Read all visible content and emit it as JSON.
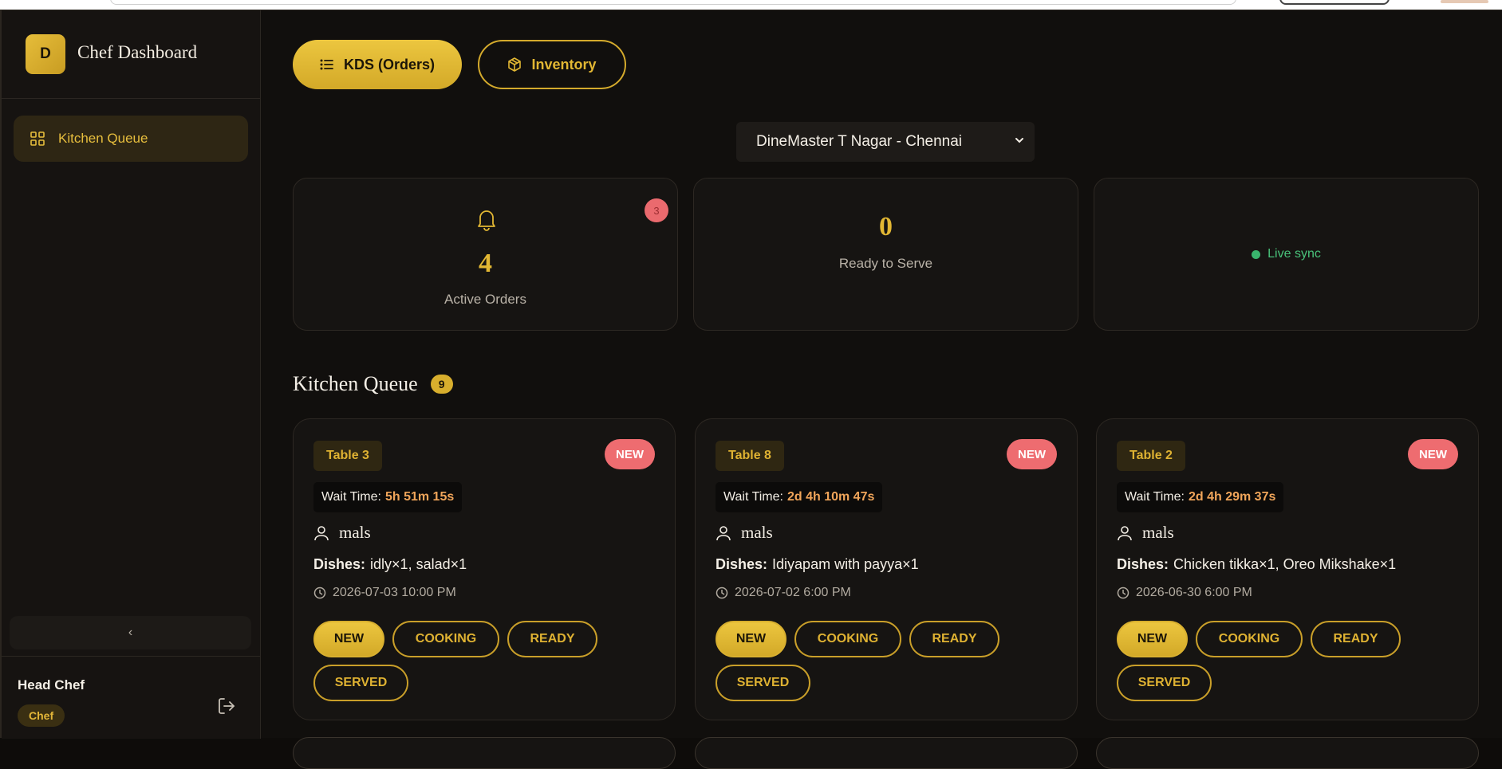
{
  "sidebar": {
    "brand_initial": "D",
    "brand_title": "Chef Dashboard",
    "nav_items": [
      {
        "label": "Kitchen Queue",
        "icon": "grid-icon",
        "active": true
      }
    ],
    "collapse_glyph": "‹",
    "user": {
      "name": "Head Chef",
      "role": "Chef"
    }
  },
  "tabs": [
    {
      "label": "KDS (Orders)",
      "icon": "list-icon",
      "active": true
    },
    {
      "label": "Inventory",
      "icon": "box-icon",
      "active": false
    }
  ],
  "branch_select": {
    "value": "DineMaster T Nagar - Chennai"
  },
  "stats": {
    "active_orders": {
      "value": "4",
      "label": "Active Orders",
      "alert": "3"
    },
    "ready_to_serve": {
      "value": "0",
      "label": "Ready to Serve"
    },
    "sync": {
      "label": "Live sync"
    }
  },
  "queue": {
    "title": "Kitchen Queue",
    "count": "9",
    "orders": [
      {
        "table": "Table 3",
        "status_badge": "NEW",
        "wait_label": "Wait Time:",
        "wait_value": "5h 51m 15s",
        "customer": "mals",
        "dishes_label": "Dishes:",
        "dishes": "idly×1, salad×1",
        "time": "2026-07-03 10:00 PM"
      },
      {
        "table": "Table 8",
        "status_badge": "NEW",
        "wait_label": "Wait Time:",
        "wait_value": "2d 4h 10m 47s",
        "customer": "mals",
        "dishes_label": "Dishes:",
        "dishes": "Idiyapam with payya×1",
        "time": "2026-07-02 6:00 PM"
      },
      {
        "table": "Table 2",
        "status_badge": "NEW",
        "wait_label": "Wait Time:",
        "wait_value": "2d 4h 29m 37s",
        "customer": "mals",
        "dishes_label": "Dishes:",
        "dishes": "Chicken tikka×1, Oreo Mikshake×1",
        "time": "2026-06-30 6:00 PM"
      }
    ],
    "status_buttons": [
      "NEW",
      "COOKING",
      "READY",
      "SERVED"
    ]
  },
  "colors": {
    "accent": "#e2b733",
    "alert": "#ee6c70",
    "live": "#39b56d",
    "background": "#110f0d"
  }
}
